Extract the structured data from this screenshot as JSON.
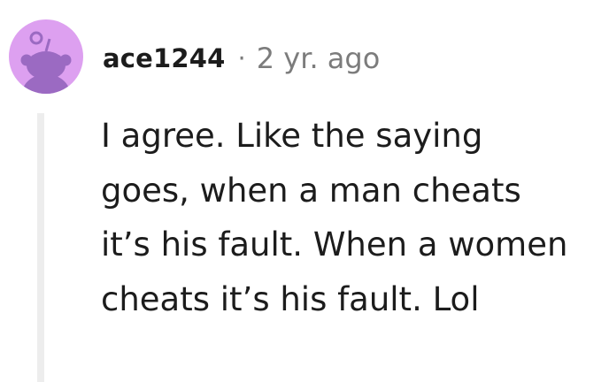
{
  "comment": {
    "author": "ace1244",
    "separator": "·",
    "timestamp": "2 yr. ago",
    "body": "I agree. Like the saying goes, when a man cheats it’s his fault. When a women cheats it’s his fault. Lol"
  },
  "colors": {
    "avatar_background": "#DDA0F0",
    "avatar_figure": "#9B6AC2",
    "text": "#1C1C1C",
    "muted_text": "#7C7C7C",
    "thread_line": "#EDEDED"
  },
  "icons": {
    "avatar": "reddit-snoo-avatar-icon"
  }
}
